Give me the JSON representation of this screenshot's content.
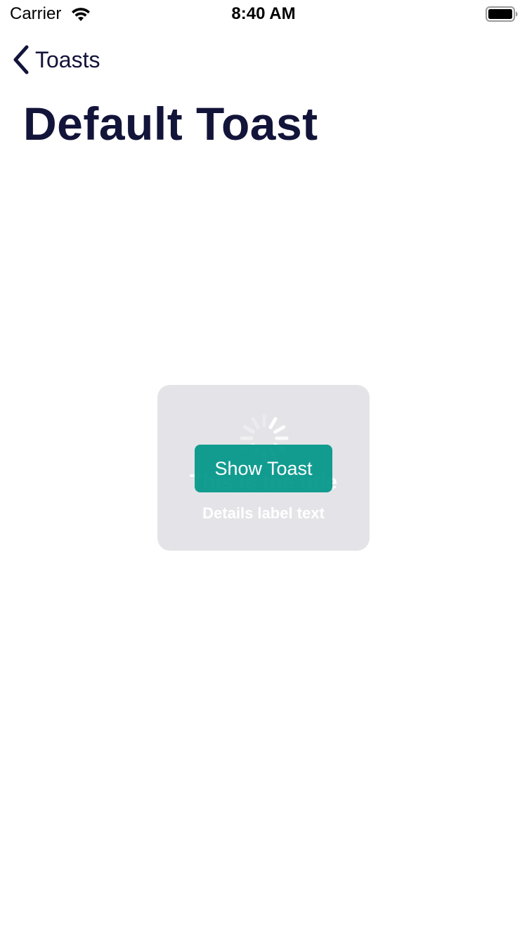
{
  "status_bar": {
    "carrier": "Carrier",
    "time": "8:40 AM",
    "wifi_icon": "wifi-icon",
    "battery_icon": "battery-icon"
  },
  "nav": {
    "back_label": "Toasts",
    "back_icon": "chevron-left-icon"
  },
  "page": {
    "title": "Default Toast"
  },
  "toast": {
    "spinner_icon": "spinner-icon",
    "title": "This is the title",
    "details": "Details label text"
  },
  "action": {
    "show_toast_label": "Show Toast"
  },
  "colors": {
    "text_primary": "#13143a",
    "accent": "#009688",
    "toast_background": "#e4e4e8"
  }
}
